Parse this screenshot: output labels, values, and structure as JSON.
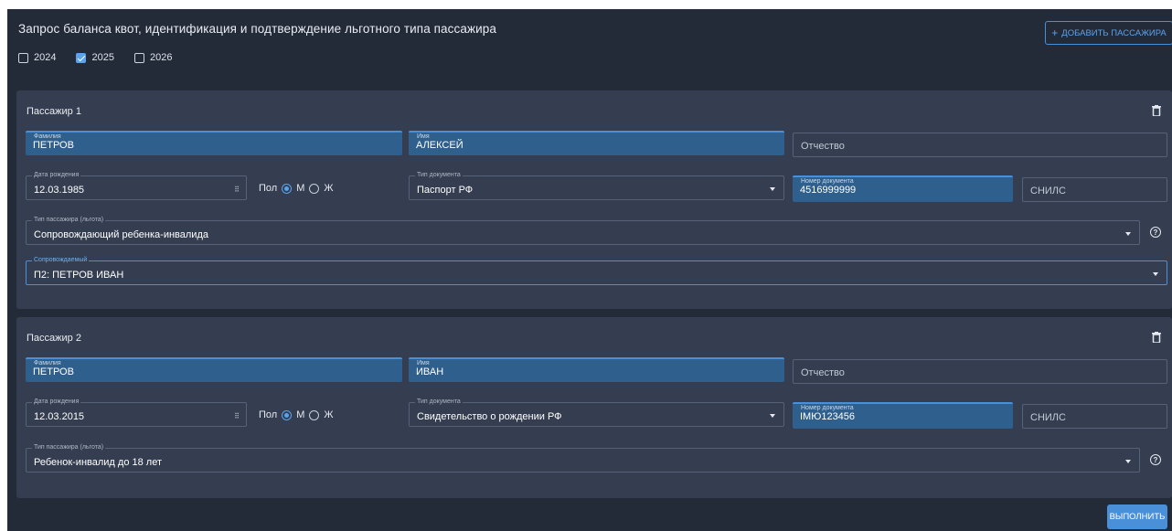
{
  "header": {
    "title": "Запрос баланса квот, идентификация и подтверждение льготного типа пассажира",
    "add_button": "ДОБАВИТЬ ПАССАЖИРА",
    "add_icon": "+"
  },
  "years": [
    {
      "label": "2024",
      "checked": false
    },
    {
      "label": "2025",
      "checked": true
    },
    {
      "label": "2026",
      "checked": false
    }
  ],
  "labels": {
    "last_name": "Фамилия",
    "first_name": "Имя",
    "middle_name": "Отчество",
    "birth_date": "Дата рождения",
    "gender": "Пол",
    "male": "М",
    "female": "Ж",
    "doc_type": "Тип документа",
    "doc_number": "Номер документа",
    "snils": "СНИЛС",
    "passenger_type": "Тип пассажира (льгота)",
    "accompanied": "Сопровождаемый"
  },
  "passengers": [
    {
      "title": "Пассажир 1",
      "last_name": "ПЕТРОВ",
      "first_name": "АЛЕКСЕЙ",
      "birth_date": "12.03.1985",
      "gender": "M",
      "doc_type": "Паспорт РФ",
      "doc_number": "4516999999",
      "passenger_type": "Сопровождающий ребенка-инвалида",
      "accompanied": "П2: ПЕТРОВ ИВАН"
    },
    {
      "title": "Пассажир 2",
      "last_name": "ПЕТРОВ",
      "first_name": "ИВАН",
      "birth_date": "12.03.2015",
      "gender": "M",
      "doc_type": "Свидетельство о рождении РФ",
      "doc_number": "IМЮ123456",
      "passenger_type": "Ребенок-инвалид до 18 лет"
    }
  ],
  "footer": {
    "run_button": "ВЫПОЛНИТЬ"
  },
  "icons": {
    "help": "?",
    "calendar": "⠿"
  },
  "colors": {
    "accent": "#4a90d9",
    "background": "#232a38",
    "card": "#343e50",
    "filled_field": "#2f5f8c"
  }
}
